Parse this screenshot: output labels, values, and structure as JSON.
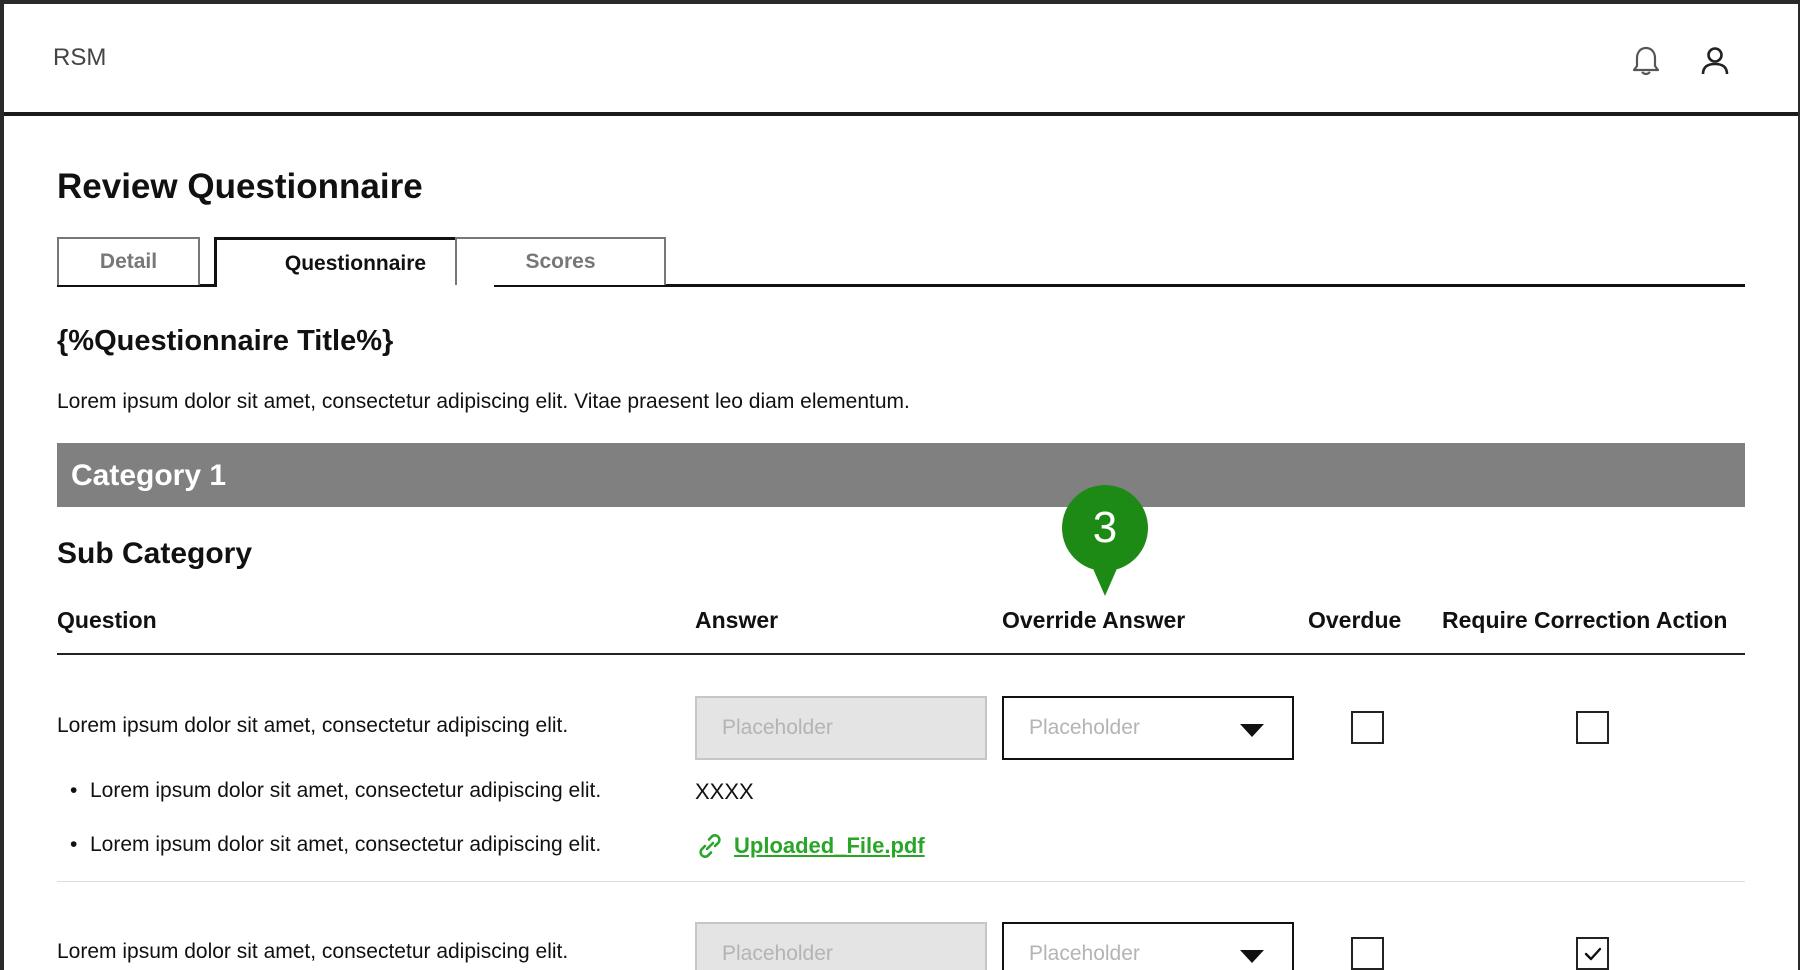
{
  "app": {
    "brand": "RSM"
  },
  "header_icons": {
    "bell": "bell-icon",
    "user": "user-icon"
  },
  "page": {
    "title": "Review Questionnaire",
    "tabs": [
      {
        "label": "Detail",
        "active": false
      },
      {
        "label": "Questionnaire",
        "active": true
      },
      {
        "label": "Scores",
        "active": false
      }
    ],
    "questionnaire_title": "{%Questionnaire Title%}",
    "description": "Lorem ipsum dolor sit amet, consectetur adipiscing elit. Vitae praesent leo diam elementum."
  },
  "category": {
    "label": "Category 1",
    "color": "#808080"
  },
  "subcategory": {
    "label": "Sub Category"
  },
  "table": {
    "headers": {
      "question": "Question",
      "answer": "Answer",
      "override": "Override Answer",
      "overdue": "Overdue",
      "require": "Require Correction Action"
    },
    "rows": [
      {
        "question": "Lorem ipsum dolor sit amet, consectetur adipiscing elit.",
        "answer_placeholder": "Placeholder",
        "override_placeholder": "Placeholder",
        "overdue": false,
        "require": false,
        "bullets": [
          "Lorem ipsum dolor sit amet, consectetur adipiscing elit.",
          "Lorem ipsum dolor sit amet, consectetur adipiscing elit."
        ],
        "answer_value": "XXXX",
        "file_name": "Uploaded_File.pdf"
      },
      {
        "question": "Lorem ipsum dolor sit amet, consectetur adipiscing elit.",
        "answer_placeholder": "Placeholder",
        "override_placeholder": "Placeholder",
        "overdue": false,
        "require": true
      }
    ]
  },
  "annotation": {
    "number": "3",
    "color": "#1e8a16"
  },
  "colors": {
    "link": "#2aa52a",
    "accent_green": "#1e8a16"
  }
}
